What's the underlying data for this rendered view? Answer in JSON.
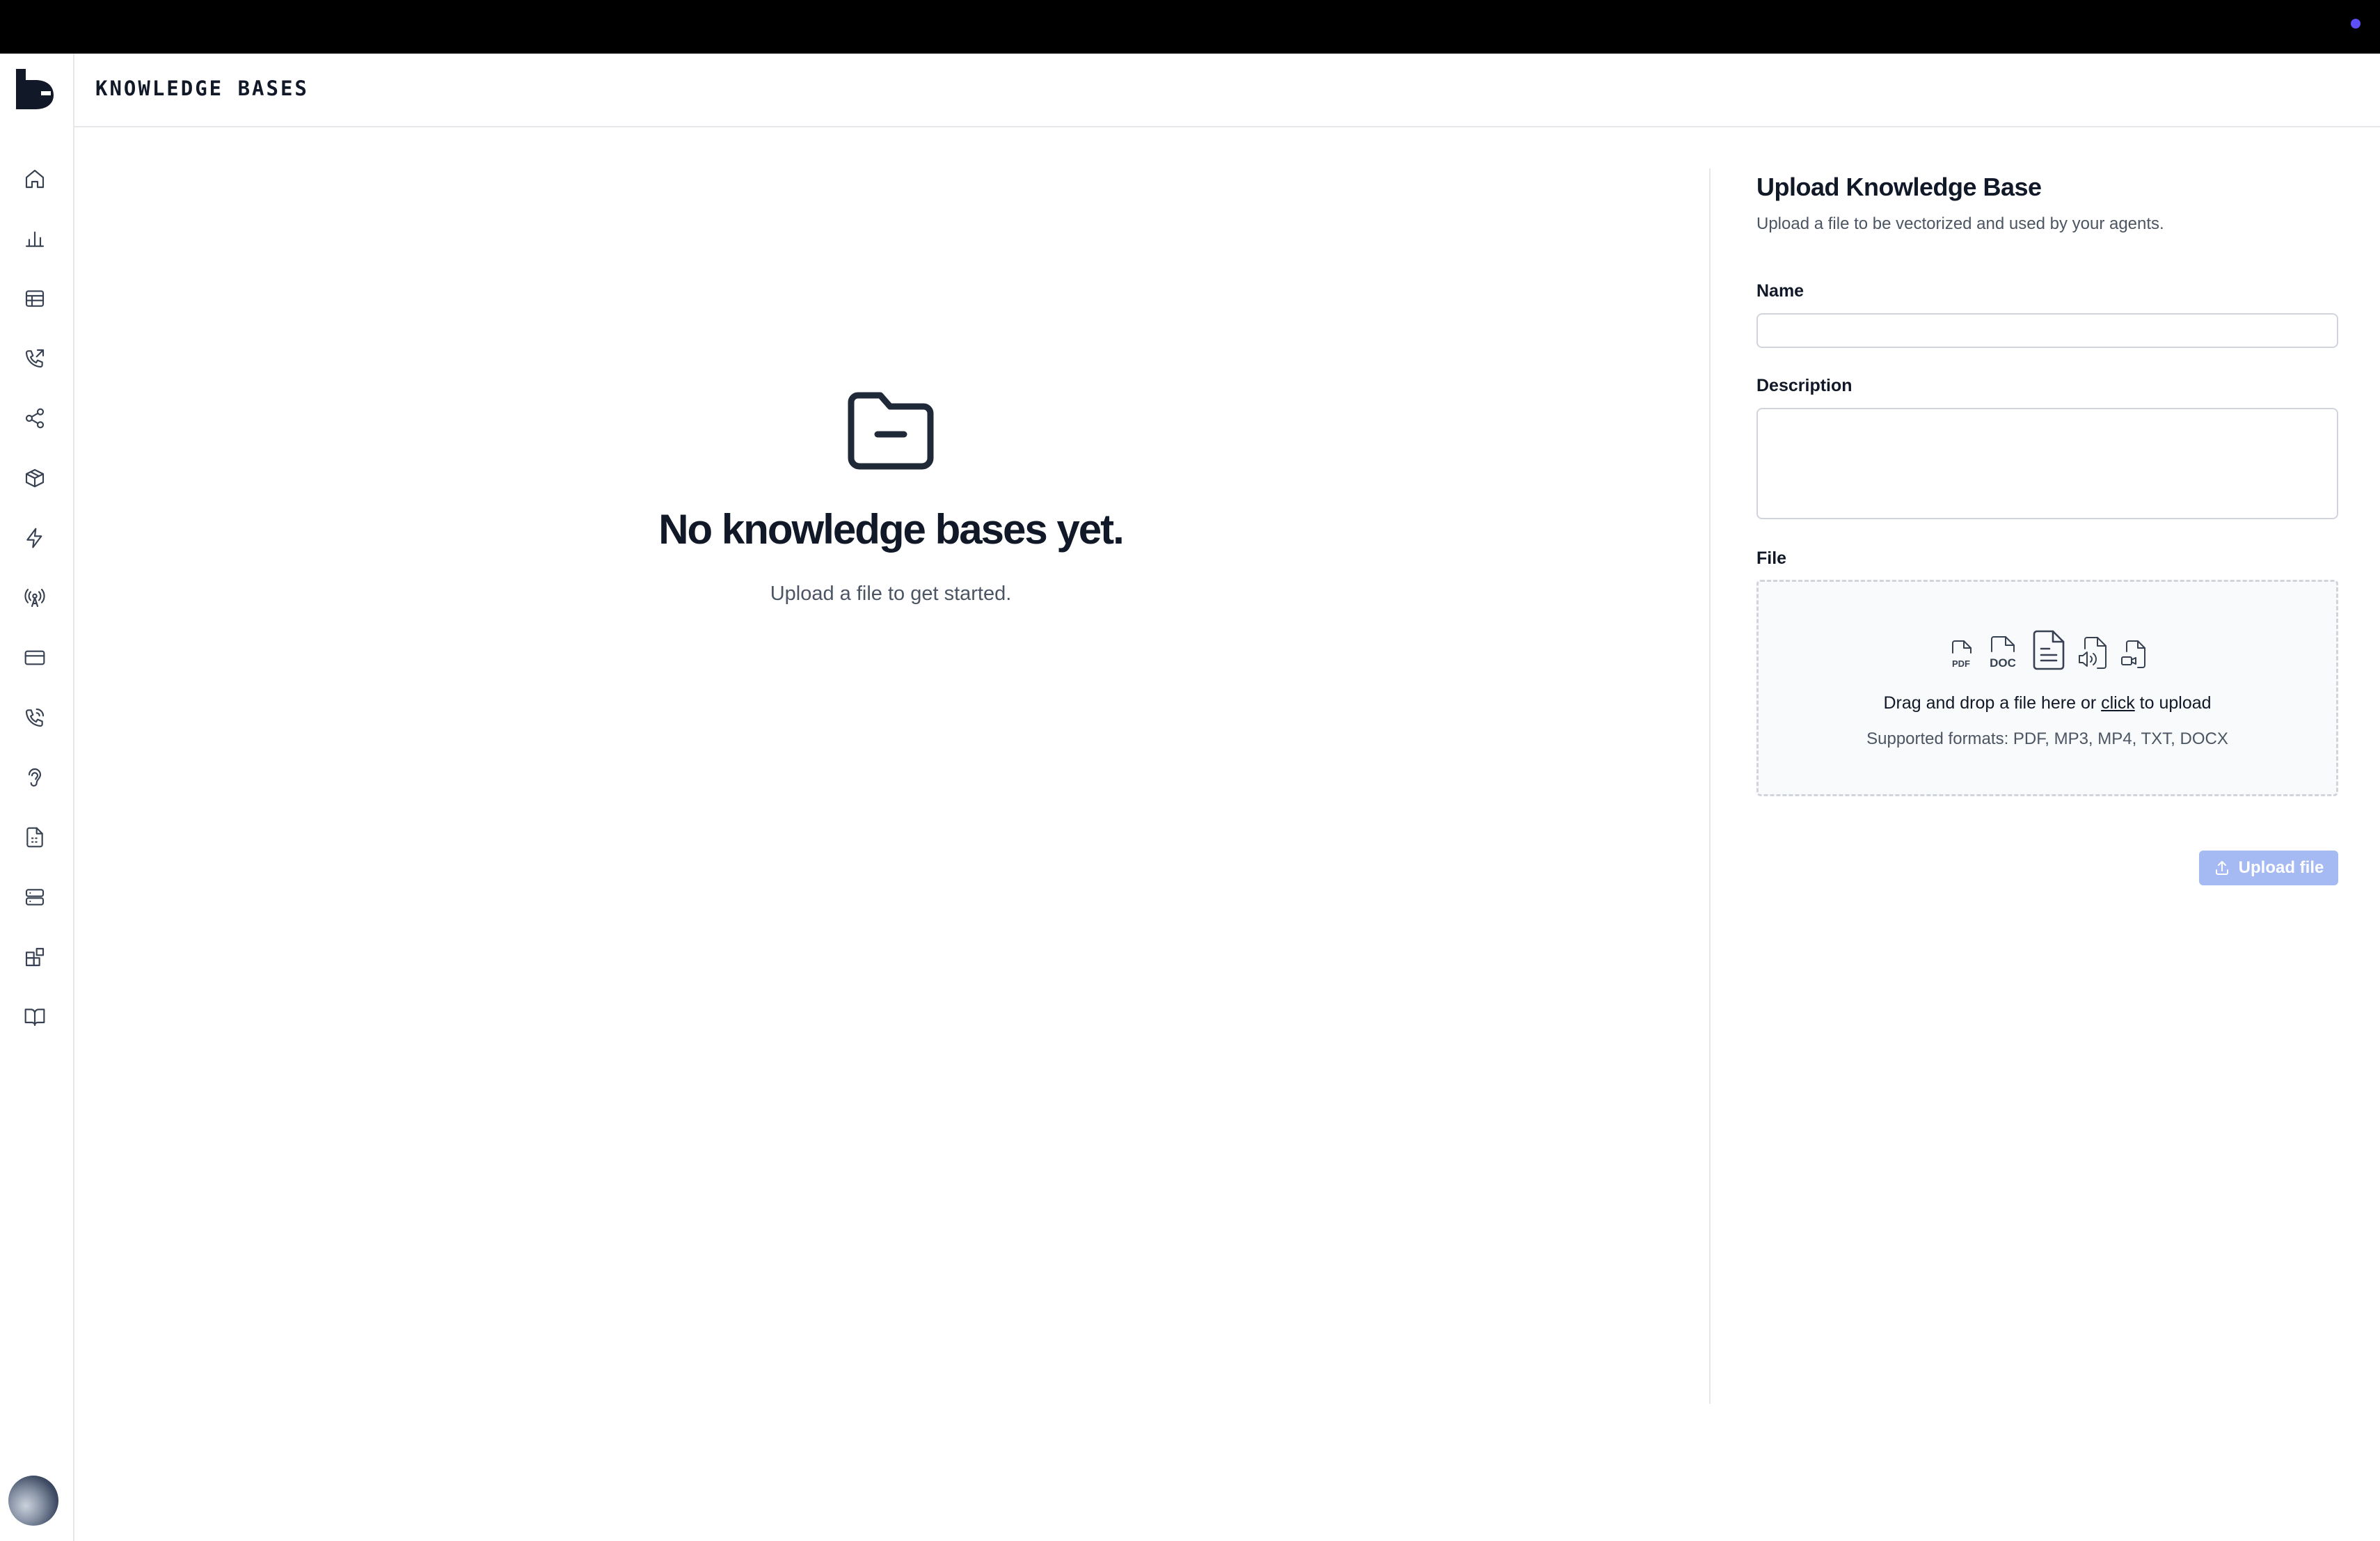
{
  "header": {
    "title": "KNOWLEDGE BASES"
  },
  "sidebar": {
    "items": [
      {
        "icon": "home-icon"
      },
      {
        "icon": "bar-chart-icon"
      },
      {
        "icon": "table-icon"
      },
      {
        "icon": "phone-outgoing-icon"
      },
      {
        "icon": "share-nodes-icon"
      },
      {
        "icon": "box-icon"
      },
      {
        "icon": "lightning-icon"
      },
      {
        "icon": "radio-tower-icon"
      },
      {
        "icon": "credit-card-icon"
      },
      {
        "icon": "phone-call-icon"
      },
      {
        "icon": "ear-icon"
      },
      {
        "icon": "file-dashed-icon"
      },
      {
        "icon": "server-icon"
      },
      {
        "icon": "blocks-icon"
      },
      {
        "icon": "book-open-icon"
      }
    ]
  },
  "empty_state": {
    "icon": "folder-minus-icon",
    "title": "No knowledge bases yet.",
    "subtitle": "Upload a file to get started."
  },
  "upload_panel": {
    "title": "Upload Knowledge Base",
    "subtitle": "Upload a file to be vectorized and used by your agents.",
    "name_label": "Name",
    "name_value": "",
    "description_label": "Description",
    "description_value": "",
    "file_label": "File",
    "drop_text_before": "Drag and drop a file here or ",
    "drop_text_link": "click",
    "drop_text_after": " to upload",
    "formats": "Supported formats: PDF, MP3, MP4, TXT, DOCX",
    "file_icons": [
      "pdf-file-icon",
      "doc-file-icon",
      "text-file-icon",
      "audio-file-icon",
      "video-file-icon"
    ],
    "upload_button": "Upload file"
  },
  "colors": {
    "topbar": "#000000",
    "accent_dot": "#5b4ff5",
    "upload_button_disabled": "#a5b9f2"
  }
}
